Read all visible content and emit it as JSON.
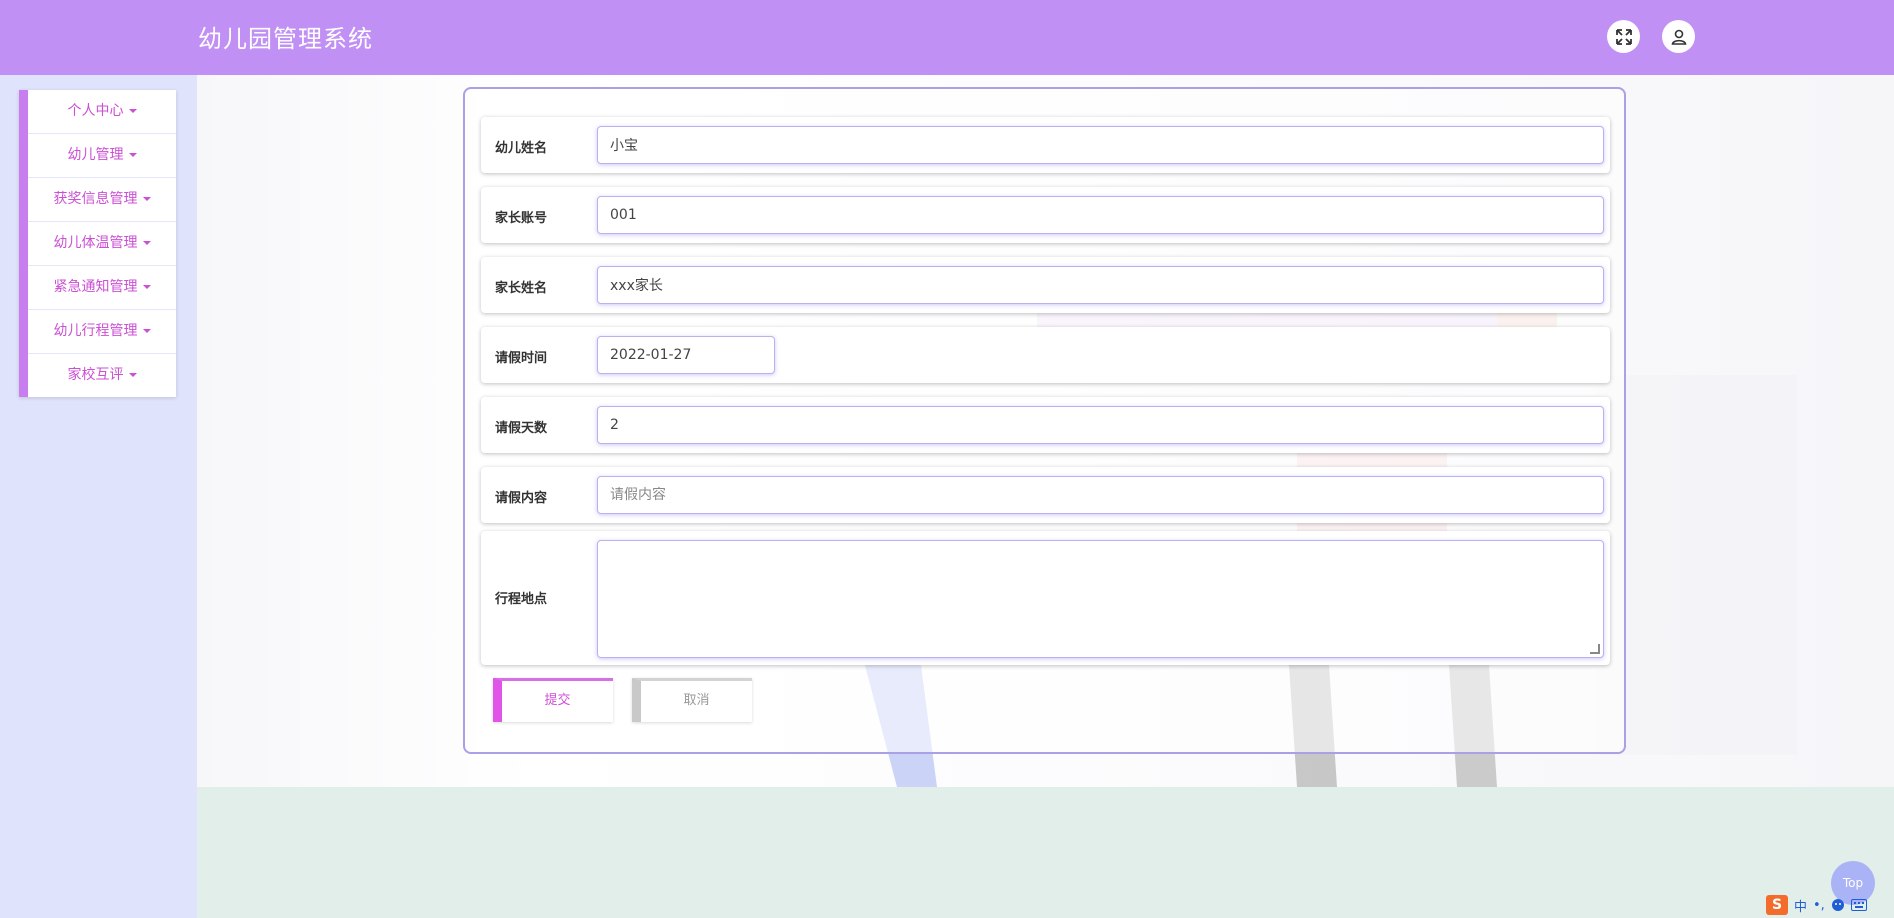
{
  "header": {
    "title": "幼儿园管理系统",
    "icons": [
      "expand-icon",
      "user-icon"
    ]
  },
  "sidebar": {
    "items": [
      {
        "label": "个人中心"
      },
      {
        "label": "幼儿管理"
      },
      {
        "label": "获奖信息管理"
      },
      {
        "label": "幼儿体温管理"
      },
      {
        "label": "紧急通知管理"
      },
      {
        "label": "幼儿行程管理"
      },
      {
        "label": "家校互评"
      }
    ]
  },
  "form": {
    "child_name": {
      "label": "幼儿姓名",
      "value": "小宝"
    },
    "parent_account": {
      "label": "家长账号",
      "value": "001"
    },
    "parent_name": {
      "label": "家长姓名",
      "value": "xxx家长"
    },
    "leave_date": {
      "label": "请假时间",
      "value": "2022-01-27"
    },
    "leave_days": {
      "label": "请假天数",
      "value": "2"
    },
    "leave_content": {
      "label": "请假内容",
      "placeholder": "请假内容"
    },
    "trip_location": {
      "label": "行程地点",
      "value": ""
    }
  },
  "buttons": {
    "submit": "提交",
    "cancel": "取消",
    "top": "Top"
  },
  "ime": {
    "logo": "S",
    "mode": "中",
    "punct": "•,"
  },
  "colors": {
    "header_bg": "#c190f4",
    "sidebar_bg": "#dfe3fb",
    "menu_text": "#cc4fd4",
    "accent": "#e055e7",
    "card_border": "#a9a0e6"
  }
}
